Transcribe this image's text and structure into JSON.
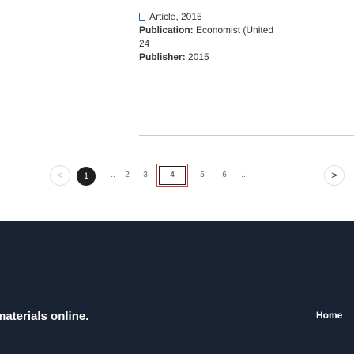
{
  "record": {
    "type_label": "Article, 2015",
    "publication_label": "Publication:",
    "publication_value": "Economist (United",
    "publication_value_2": "24",
    "publisher_label": "Publisher:",
    "publisher_value": "2015",
    "icon": "book-icon"
  },
  "pagination": {
    "prev_symbol": "<",
    "next_symbol": ">",
    "current_page": "1",
    "pages": [
      "2",
      "3",
      "4",
      "5",
      "6"
    ],
    "ellipsis_1": "..",
    "ellipsis_2": "..",
    "focused_page": "4"
  },
  "footer": {
    "tagline": "materials online.",
    "home_link": "Home",
    "background_color": "#1a2333"
  },
  "colors": {
    "icon_accent": "#2a5fa8",
    "current_page_bg": "#1f1f1f",
    "focus_outline": "#d83a3a"
  }
}
